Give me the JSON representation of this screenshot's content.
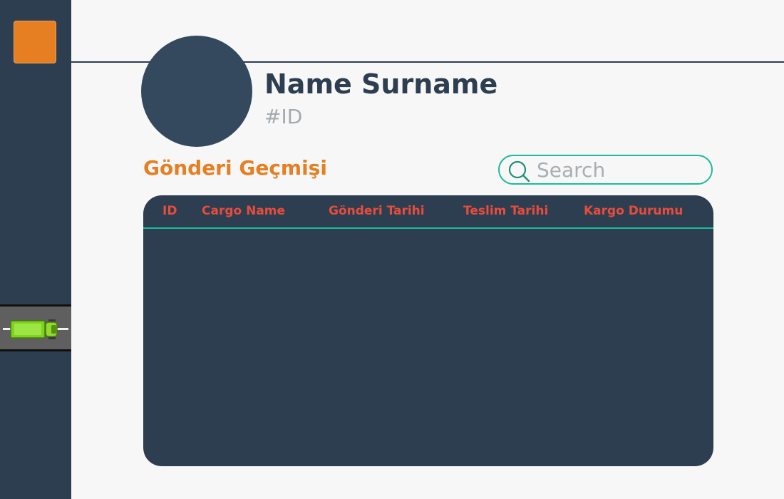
{
  "profile": {
    "name": "Name Surname",
    "id": "#ID"
  },
  "section": {
    "title": "Gönderi Geçmişi"
  },
  "search": {
    "placeholder": "Search",
    "value": ""
  },
  "table": {
    "columns": [
      "ID",
      "Cargo Name",
      "Gönderi Tarihi",
      "Teslim Tarihi",
      "Kargo Durumu"
    ],
    "rows": []
  },
  "icons": {
    "logo": "logo-square-icon",
    "truck": "truck-icon",
    "search": "search-icon"
  },
  "colors": {
    "sidebar": "#2d3e50",
    "accent_orange": "#e67e22",
    "accent_teal": "#1abc9c",
    "header_red": "#e74c3c",
    "background": "#f7f7f7",
    "truck_green": "#7ed321"
  }
}
